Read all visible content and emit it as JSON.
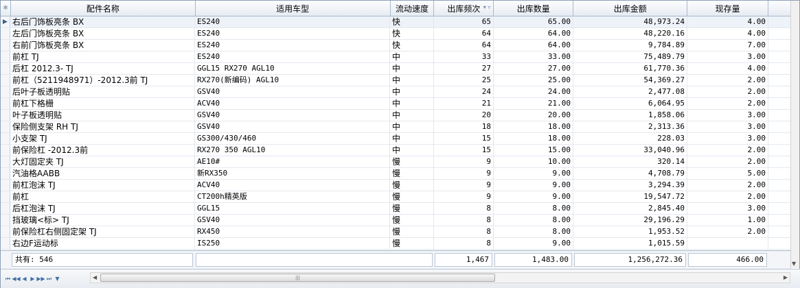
{
  "columns": {
    "name": "配件名称",
    "car": "适用车型",
    "speed": "流动速度",
    "freq": "出库频次",
    "qty": "出库数量",
    "amount": "出库金额",
    "stock": "现存量"
  },
  "rows": [
    {
      "name": "右后门饰板亮条 BX",
      "car": "ES240",
      "speed": "快",
      "freq": "65",
      "qty": "65.00",
      "amount": "48,973.24",
      "stock": "4.00"
    },
    {
      "name": "左后门饰板亮条 BX",
      "car": "ES240",
      "speed": "快",
      "freq": "64",
      "qty": "64.00",
      "amount": "48,220.16",
      "stock": "4.00"
    },
    {
      "name": "右前门饰板亮条 BX",
      "car": "ES240",
      "speed": "快",
      "freq": "64",
      "qty": "64.00",
      "amount": "9,784.89",
      "stock": "7.00"
    },
    {
      "name": "前杠 TJ",
      "car": "ES240",
      "speed": "中",
      "freq": "33",
      "qty": "33.00",
      "amount": "75,489.79",
      "stock": "3.00"
    },
    {
      "name": "后杠 2012.3- TJ",
      "car": "GGL15 RX270 AGL10",
      "speed": "中",
      "freq": "27",
      "qty": "27.00",
      "amount": "61,770.36",
      "stock": "4.00"
    },
    {
      "name": "前杠（5211948971）-2012.3前 TJ",
      "car": "RX270(新编码) AGL10",
      "speed": "中",
      "freq": "25",
      "qty": "25.00",
      "amount": "54,369.27",
      "stock": "2.00"
    },
    {
      "name": "后叶子板透明贴",
      "car": "GSV40",
      "speed": "中",
      "freq": "24",
      "qty": "24.00",
      "amount": "2,477.08",
      "stock": "2.00"
    },
    {
      "name": "前杠下格栅",
      "car": "ACV40",
      "speed": "中",
      "freq": "21",
      "qty": "21.00",
      "amount": "6,064.95",
      "stock": "2.00"
    },
    {
      "name": "叶子板透明贴",
      "car": "GSV40",
      "speed": "中",
      "freq": "20",
      "qty": "20.00",
      "amount": "1,858.06",
      "stock": "3.00"
    },
    {
      "name": "保险侧支架 RH TJ",
      "car": "GSV40",
      "speed": "中",
      "freq": "18",
      "qty": "18.00",
      "amount": "2,313.36",
      "stock": "3.00"
    },
    {
      "name": "小支架 TJ",
      "car": "GS300/430/460",
      "speed": "中",
      "freq": "15",
      "qty": "18.00",
      "amount": "228.03",
      "stock": "3.00"
    },
    {
      "name": "前保险杠 -2012.3前",
      "car": "RX270 350 AGL10",
      "speed": "中",
      "freq": "15",
      "qty": "15.00",
      "amount": "33,040.96",
      "stock": "2.00"
    },
    {
      "name": "大灯固定夹  TJ",
      "car": "AE10#",
      "speed": "慢",
      "freq": "9",
      "qty": "10.00",
      "amount": "320.14",
      "stock": "2.00"
    },
    {
      "name": "汽油格AABB",
      "car": "新RX350",
      "speed": "慢",
      "freq": "9",
      "qty": "9.00",
      "amount": "4,708.79",
      "stock": "5.00"
    },
    {
      "name": "前杠泡沫 TJ",
      "car": "ACV40",
      "speed": "慢",
      "freq": "9",
      "qty": "9.00",
      "amount": "3,294.39",
      "stock": "2.00"
    },
    {
      "name": "前杠",
      "car": "CT200h精英版",
      "speed": "慢",
      "freq": "9",
      "qty": "9.00",
      "amount": "19,547.72",
      "stock": "2.00"
    },
    {
      "name": "后杠泡沫 TJ",
      "car": "GGL15",
      "speed": "慢",
      "freq": "8",
      "qty": "8.00",
      "amount": "2,845.40",
      "stock": "3.00"
    },
    {
      "name": "挡玻璃<标> TJ",
      "car": "GSV40",
      "speed": "慢",
      "freq": "8",
      "qty": "8.00",
      "amount": "29,196.29",
      "stock": "1.00"
    },
    {
      "name": "前保险杠右侧固定架 TJ",
      "car": "RX450",
      "speed": "慢",
      "freq": "8",
      "qty": "8.00",
      "amount": "1,953.52",
      "stock": "2.00"
    },
    {
      "name": "右边F运动标",
      "car": "IS250",
      "speed": "慢",
      "freq": "8",
      "qty": "9.00",
      "amount": "1,015.59",
      "stock": ""
    }
  ],
  "footer": {
    "count_label": "共有: 546",
    "freq_total": "1,467",
    "qty_total": "1,483.00",
    "amount_total": "1,256,272.36",
    "stock_total": "466.00"
  },
  "colors": {
    "header_bg": "#e6ecf3",
    "border": "#a9b8c9",
    "selected_row": "#eef3fa"
  }
}
